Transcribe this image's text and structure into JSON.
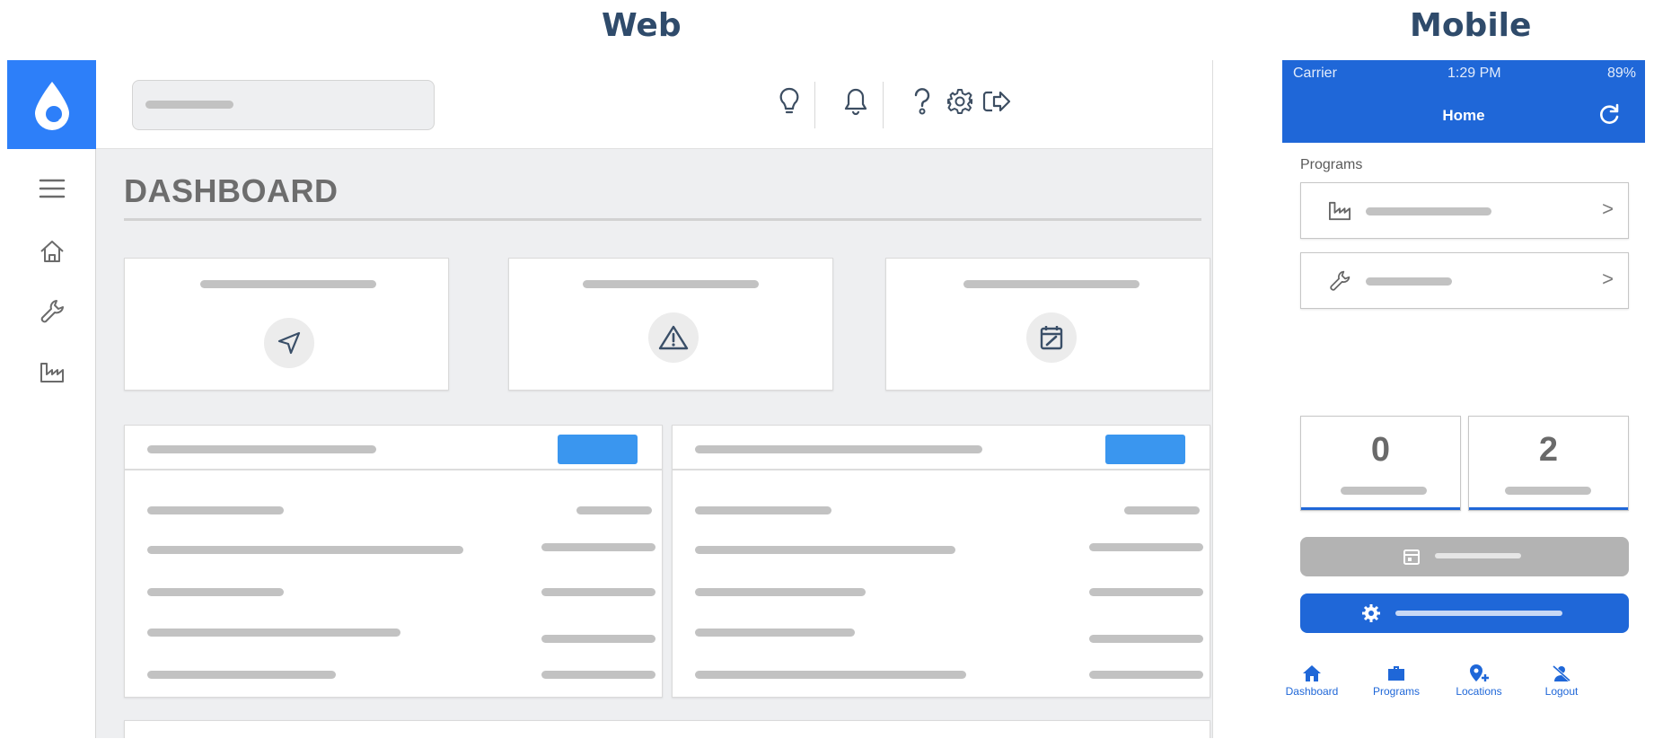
{
  "headings": {
    "web": "Web",
    "mobile": "Mobile"
  },
  "web": {
    "page_title": "DASHBOARD",
    "rail_icons": [
      "menu-icon",
      "home-icon",
      "wrench-icon",
      "factory-icon"
    ],
    "toolbar_icons": [
      "lightbulb-icon",
      "bell-icon",
      "help-icon",
      "gear-icon",
      "logout-icon"
    ],
    "summary_card_icons": [
      "navigation-icon",
      "warning-icon",
      "calendar-check-icon"
    ],
    "accent_color": "#2d7ff9",
    "button_color": "#3a96ef"
  },
  "mobile": {
    "status": {
      "carrier": "Carrier",
      "time": "1:29 PM",
      "battery": "89%"
    },
    "header_title": "Home",
    "section_label": "Programs",
    "program_rows": [
      {
        "icon": "factory-icon",
        "chevron": ">"
      },
      {
        "icon": "wrench-icon",
        "chevron": ">"
      }
    ],
    "stats": [
      {
        "value": "0"
      },
      {
        "value": "2"
      }
    ],
    "tabs": [
      {
        "label": "Dashboard",
        "icon": "home-icon"
      },
      {
        "label": "Programs",
        "icon": "briefcase-icon"
      },
      {
        "label": "Locations",
        "icon": "location-add-icon"
      },
      {
        "label": "Logout",
        "icon": "person-off-icon"
      }
    ],
    "primary_color": "#1f67d8",
    "disabled_color": "#b3b3b3"
  }
}
